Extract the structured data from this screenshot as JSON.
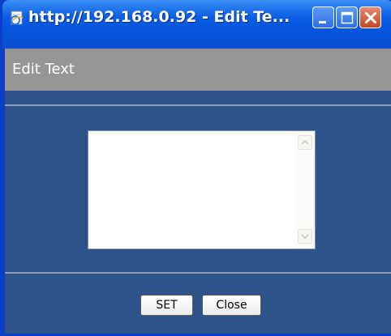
{
  "window": {
    "title": "http://192.168.0.92 - Edit Te..."
  },
  "dialog": {
    "header_title": "Edit Text",
    "textarea_value": "",
    "set_label": "SET",
    "close_label": "Close"
  },
  "icons": {
    "window": "ie-page-icon",
    "minimize": "minimize-icon",
    "maximize": "maximize-icon",
    "close": "close-icon",
    "scroll_up": "chevron-up-icon",
    "scroll_down": "chevron-down-icon"
  },
  "colors": {
    "titlebar": "#0555e0",
    "header_bar": "#969696",
    "content_bg": "#2e538a",
    "close_button": "#c44626"
  }
}
